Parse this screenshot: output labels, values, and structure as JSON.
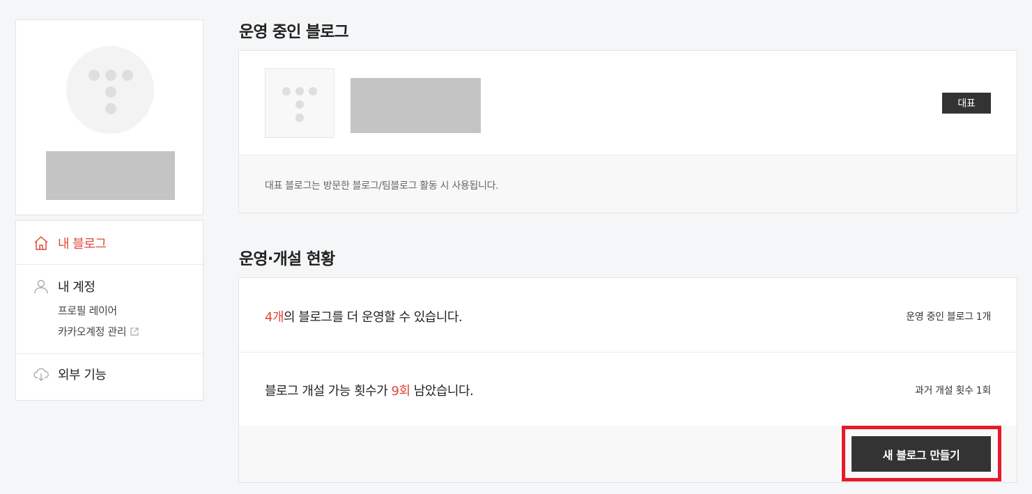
{
  "sidebar": {
    "menu": {
      "my_blog": "내 블로그",
      "my_account": "내 계정",
      "profile_layer": "프로필 레이어",
      "kakao_account": "카카오계정 관리",
      "external": "외부 기능"
    },
    "icons": {
      "home": "home-icon",
      "user": "user-icon",
      "external_link": "external-link-icon",
      "cloud_download": "cloud-download-icon"
    },
    "accent_color": "#e2463a"
  },
  "main": {
    "running_blogs": {
      "title": "운영 중인 블로그",
      "badge": "대표",
      "note": "대표 블로그는 방문한 블로그/팀블로그 활동 시 사용됩니다."
    },
    "status": {
      "title": "운영·개설 현황",
      "row1": {
        "count": "4개",
        "text": "의 블로그를 더 운영할 수 있습니다.",
        "side": "운영 중인 블로그 1개"
      },
      "row2": {
        "prefix": "블로그 개설 가능 횟수가 ",
        "count": "9회",
        "suffix": " 남았습니다.",
        "side": "과거 개설 횟수 1회"
      },
      "create_button": "새 블로그 만들기"
    }
  }
}
